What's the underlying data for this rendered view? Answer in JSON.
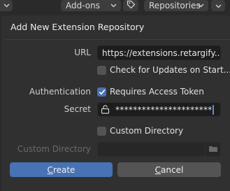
{
  "topbar": {
    "addons_label": "Add-ons",
    "repositories_label": "Repositories",
    "icons": [
      "chevron-down-icon",
      "tag-icon",
      "chevron-down-icon",
      "chevron-down-icon"
    ]
  },
  "dialog": {
    "title": "Add New Extension Repository",
    "url": {
      "label": "URL",
      "value": "https://extensions.retargify...."
    },
    "check_updates": {
      "label": "Check for Updates on Start...",
      "checked": false
    },
    "authentication": {
      "label": "Authentication",
      "requires_token_label": "Requires Access Token",
      "checked": true
    },
    "secret": {
      "label": "Secret",
      "value": "**********************"
    },
    "custom_directory_checkbox": {
      "label": "Custom Directory",
      "checked": false
    },
    "custom_directory": {
      "label": "Custom Directory",
      "value": ""
    },
    "create_label": "Create",
    "cancel_label": "Cancel"
  },
  "colors": {
    "accent": "#4772b3",
    "background": "#303030",
    "field": "#1d1d1d"
  }
}
